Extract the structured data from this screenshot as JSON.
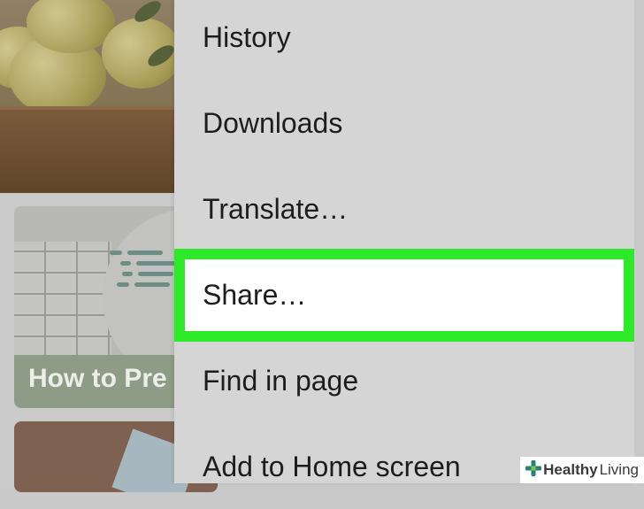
{
  "background": {
    "article_card_title": "How to Pre"
  },
  "menu": {
    "items": [
      {
        "label": "History"
      },
      {
        "label": "Downloads"
      },
      {
        "label": "Translate…"
      },
      {
        "label": "Share…"
      },
      {
        "label": "Find in page"
      },
      {
        "label": "Add to Home screen"
      }
    ],
    "highlighted_index": 3
  },
  "colors": {
    "highlight_border": "#2ee82a",
    "menu_background": "#d5d5d5"
  },
  "watermark": {
    "brand_bold": "Healthy",
    "brand_light": " Living",
    "icon": "plus-cross-icon"
  }
}
